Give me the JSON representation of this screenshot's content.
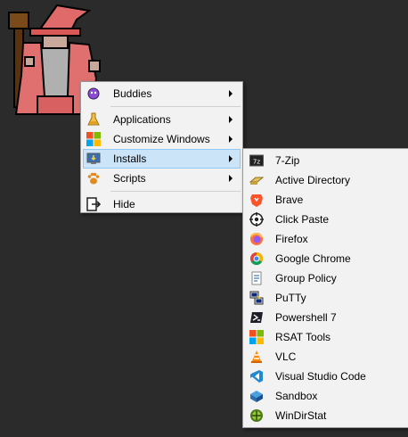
{
  "colors": {
    "background": "#2b2b2b",
    "menu_background": "#f2f2f2",
    "highlight": "#cce4f7",
    "highlight_border": "#90c8f6"
  },
  "desktop": {
    "image": "pixel-wizard-icon"
  },
  "main_menu": {
    "items": [
      {
        "label": "Buddies",
        "icon": "purple-creature-icon",
        "submenu": true
      },
      {
        "label": "Applications",
        "icon": "beaker-icon",
        "submenu": true
      },
      {
        "label": "Customize Windows",
        "icon": "windows-logo-icon",
        "submenu": true
      },
      {
        "label": "Installs",
        "icon": "monitor-install-icon",
        "submenu": true,
        "highlighted": true
      },
      {
        "label": "Scripts",
        "icon": "paw-icon",
        "submenu": true
      },
      {
        "label": "Hide",
        "icon": "exit-icon",
        "submenu": false
      }
    ]
  },
  "installs_menu": {
    "items": [
      {
        "label": "7-Zip",
        "icon": "7zip-icon"
      },
      {
        "label": "Active Directory",
        "icon": "active-directory-icon"
      },
      {
        "label": "Brave",
        "icon": "brave-lion-icon"
      },
      {
        "label": "Click Paste",
        "icon": "crosshair-icon"
      },
      {
        "label": "Firefox",
        "icon": "firefox-icon"
      },
      {
        "label": "Google Chrome",
        "icon": "chrome-icon"
      },
      {
        "label": "Group Policy",
        "icon": "group-policy-icon"
      },
      {
        "label": "PuTTy",
        "icon": "putty-icon"
      },
      {
        "label": "Powershell 7",
        "icon": "powershell-icon"
      },
      {
        "label": "RSAT Tools",
        "icon": "windows-logo-icon"
      },
      {
        "label": "VLC",
        "icon": "vlc-cone-icon"
      },
      {
        "label": "Visual Studio Code",
        "icon": "vscode-icon"
      },
      {
        "label": "Sandbox",
        "icon": "sandbox-icon"
      },
      {
        "label": "WinDirStat",
        "icon": "windirstat-icon"
      }
    ]
  }
}
